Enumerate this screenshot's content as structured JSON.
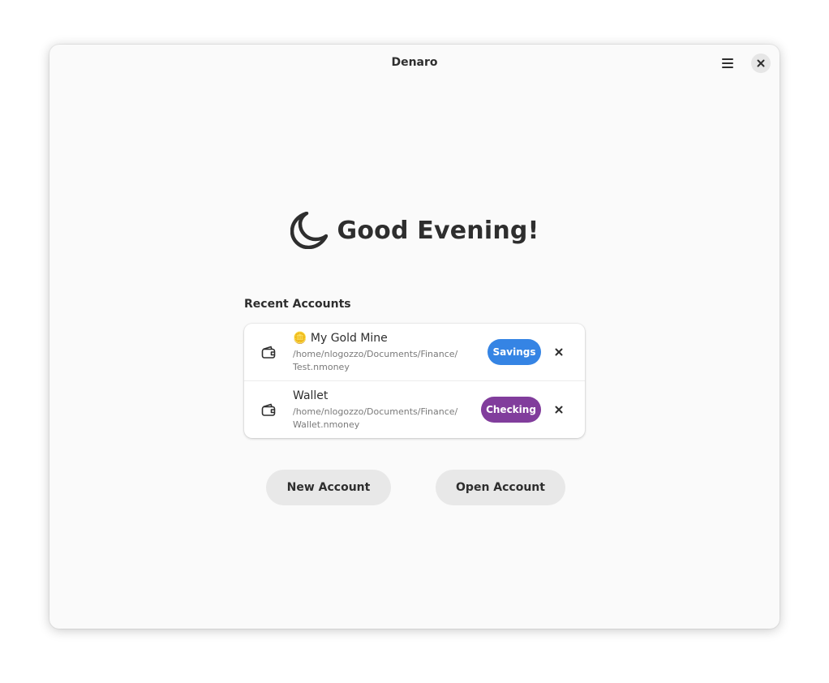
{
  "window": {
    "title": "Denaro"
  },
  "icons": {
    "menu": "hamburger-menu-icon",
    "close": "close-icon",
    "greeting": "moon-icon",
    "account": "wallet-icon",
    "remove": "remove-x-icon"
  },
  "greeting": {
    "text": "Good Evening!"
  },
  "recent": {
    "title": "Recent Accounts",
    "items": [
      {
        "title": "🪙 My Gold Mine",
        "path": "/home/nlogozzo/Documents/Finance/Test.nmoney",
        "path_line1": "/home/nlogozzo/Documents/Finance/",
        "path_line2": "Test.nmoney",
        "type": "Savings",
        "color": "#3584e4"
      },
      {
        "title": "Wallet",
        "path": "/home/nlogozzo/Documents/Finance/Wallet.nmoney",
        "path_line1": "/home/nlogozzo/Documents/Finance/",
        "path_line2": "Wallet.nmoney",
        "type": "Checking",
        "color": "#813d9c"
      }
    ]
  },
  "actions": {
    "new_account": "New Account",
    "open_account": "Open Account"
  }
}
